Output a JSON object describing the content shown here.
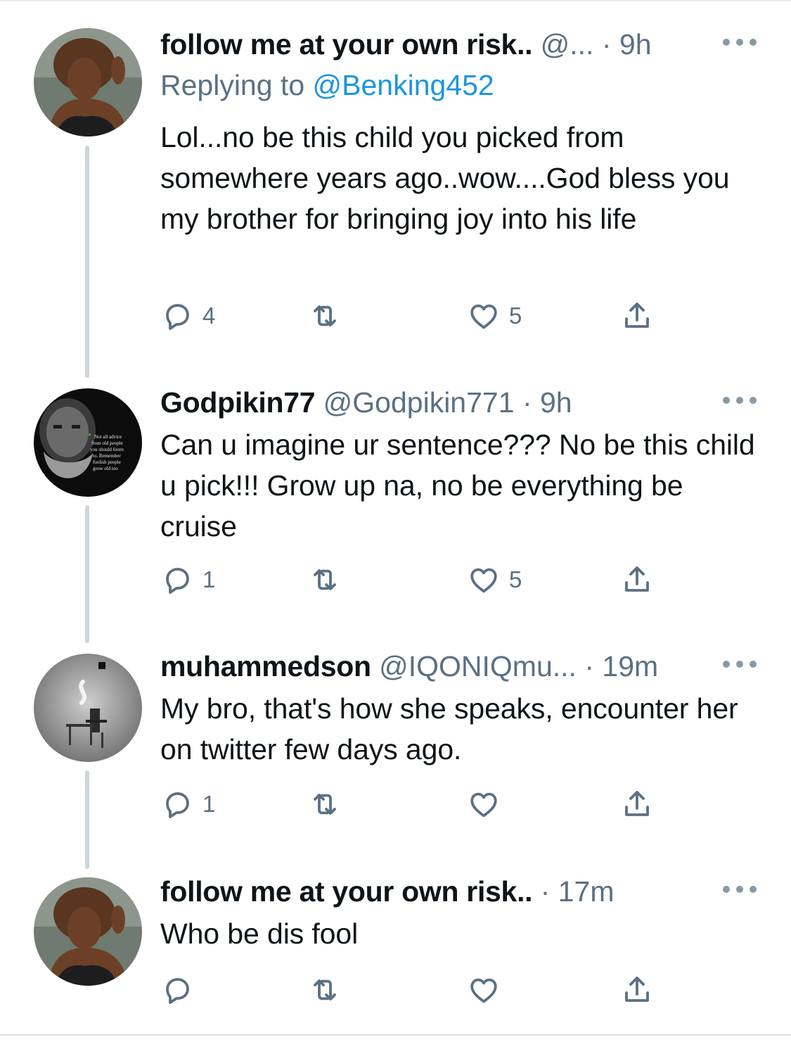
{
  "tweets": [
    {
      "display_name": "follow me at your own risk..",
      "handle": "@...",
      "separator": "·",
      "time": "9h",
      "reply_label": "Replying to",
      "reply_mention": "@Benking452",
      "text": "Lol...no be this child you picked from somewhere years ago..wow....God bless you my brother for bringing joy into his life",
      "replies": "4",
      "retweets": "",
      "likes": "5",
      "avatar": "woman-curly-hair-avatar"
    },
    {
      "display_name": "Godpikin77",
      "handle": "@Godpikin771",
      "separator": "·",
      "time": "9h",
      "text": "Can u imagine ur sentence??? No be this child u pick!!! Grow up na, no be everything be cruise",
      "replies": "1",
      "retweets": "",
      "likes": "5",
      "avatar": "old-man-quote-avatar",
      "avatar_lines": [
        "Not all advice",
        "from old people",
        "you should listen",
        "to. Remember",
        "foolish people",
        "grow old too"
      ]
    },
    {
      "display_name": "muhammedson",
      "handle": "@IQONIQmu...",
      "separator": "·",
      "time": "19m",
      "text": "My bro, that's how she speaks, encounter her on twitter few days ago.",
      "replies": "1",
      "retweets": "",
      "likes": "",
      "avatar": "surreal-man-at-table-avatar"
    },
    {
      "display_name": "follow me at your own risk..",
      "handle": "",
      "separator": "·",
      "time": "17m",
      "text": "Who be dis fool",
      "replies": "",
      "retweets": "",
      "likes": "",
      "avatar": "woman-curly-hair-avatar"
    }
  ],
  "colors": {
    "text": "#0f1419",
    "secondary": "#5b7083",
    "link": "#1b95e0",
    "thread_line": "#d0d5d9"
  }
}
